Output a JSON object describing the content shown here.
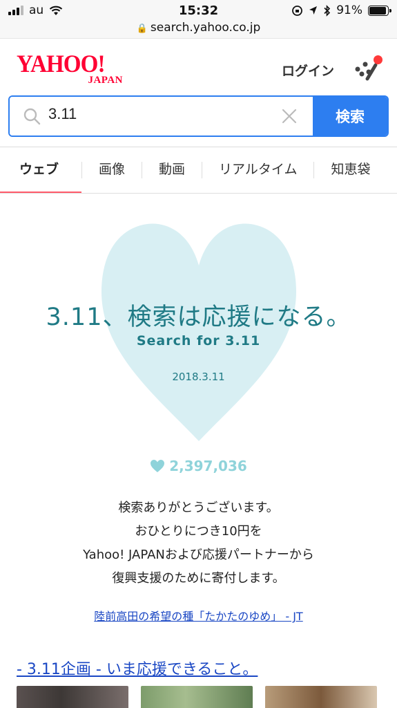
{
  "status_bar": {
    "carrier": "au",
    "time": "15:32",
    "battery": "91%",
    "battery_level": 0.91
  },
  "url_bar": {
    "url": "search.yahoo.co.jp"
  },
  "header": {
    "logo_text": "YAHOO!",
    "logo_subtext": "JAPAN",
    "login_label": "ログイン",
    "brand_color": "#ff0033"
  },
  "search": {
    "query": "3.11",
    "button_label": "検索",
    "accent_color": "#2d7ef0"
  },
  "tabs": [
    {
      "label": "ウェブ",
      "active": true
    },
    {
      "label": "画像",
      "active": false
    },
    {
      "label": "動画",
      "active": false
    },
    {
      "label": "リアルタイム",
      "active": false
    },
    {
      "label": "知恵袋",
      "active": false
    }
  ],
  "campaign": {
    "title": "3.11、検索は応援になる。",
    "subtitle": "Search for 3.11",
    "date": "2018.3.11",
    "count": "2,397,036",
    "message_lines": [
      "検索ありがとうございます。",
      "おひとりにつき10円を",
      "Yahoo! JAPANおよび応援パートナーから",
      "復興支援のために寄付します。"
    ],
    "sponsor_link": "陸前高田の希望の種「たかたのゆめ」 - JT",
    "heart_color": "#d8eff3",
    "text_color": "#1f7a85"
  },
  "section": {
    "link_text": "- 3.11企画 - いま応援できること。"
  }
}
